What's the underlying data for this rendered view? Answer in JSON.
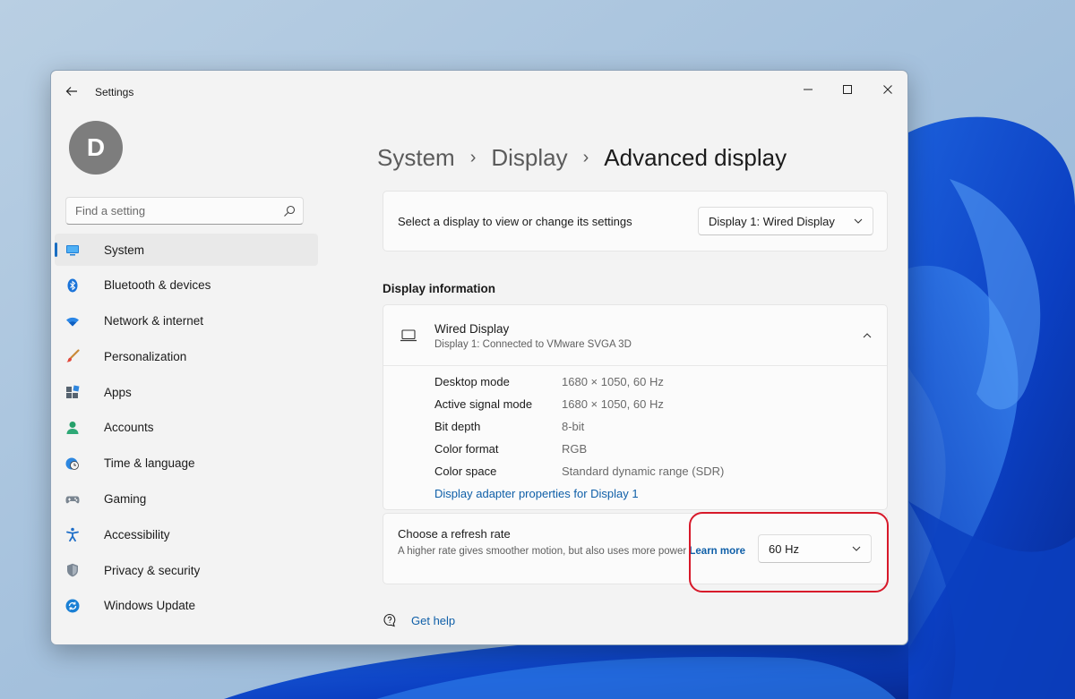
{
  "window": {
    "app_title": "Settings"
  },
  "user": {
    "avatar_letter": "D"
  },
  "search": {
    "placeholder": "Find a setting"
  },
  "sidebar": {
    "items": [
      {
        "label": "System",
        "icon": "system-icon",
        "selected": true
      },
      {
        "label": "Bluetooth & devices",
        "icon": "bluetooth-icon"
      },
      {
        "label": "Network & internet",
        "icon": "wifi-icon"
      },
      {
        "label": "Personalization",
        "icon": "brush-icon"
      },
      {
        "label": "Apps",
        "icon": "apps-icon"
      },
      {
        "label": "Accounts",
        "icon": "person-icon"
      },
      {
        "label": "Time & language",
        "icon": "globe-clock-icon"
      },
      {
        "label": "Gaming",
        "icon": "gamepad-icon"
      },
      {
        "label": "Accessibility",
        "icon": "accessibility-icon"
      },
      {
        "label": "Privacy & security",
        "icon": "shield-icon"
      },
      {
        "label": "Windows Update",
        "icon": "update-icon"
      }
    ]
  },
  "breadcrumb": {
    "items": [
      "System",
      "Display",
      "Advanced display"
    ]
  },
  "display_select": {
    "label": "Select a display to view or change its settings",
    "value": "Display 1: Wired Display"
  },
  "display_info": {
    "section_title": "Display information",
    "name": "Wired Display",
    "subtitle": "Display 1: Connected to VMware SVGA 3D",
    "rows": [
      {
        "key": "Desktop mode",
        "value": "1680 × 1050, 60 Hz"
      },
      {
        "key": "Active signal mode",
        "value": "1680 × 1050, 60 Hz"
      },
      {
        "key": "Bit depth",
        "value": "8-bit"
      },
      {
        "key": "Color format",
        "value": "RGB"
      },
      {
        "key": "Color space",
        "value": "Standard dynamic range (SDR)"
      }
    ],
    "adapter_link": "Display adapter properties for Display 1"
  },
  "refresh_rate": {
    "title": "Choose a refresh rate",
    "description": "A higher rate gives smoother motion, but also uses more power",
    "learn_more": "Learn more",
    "value": "60 Hz"
  },
  "help": {
    "label": "Get help"
  },
  "colors": {
    "accent": "#1a6ec2",
    "link": "#0f5fa8",
    "highlight": "#d7192a"
  }
}
